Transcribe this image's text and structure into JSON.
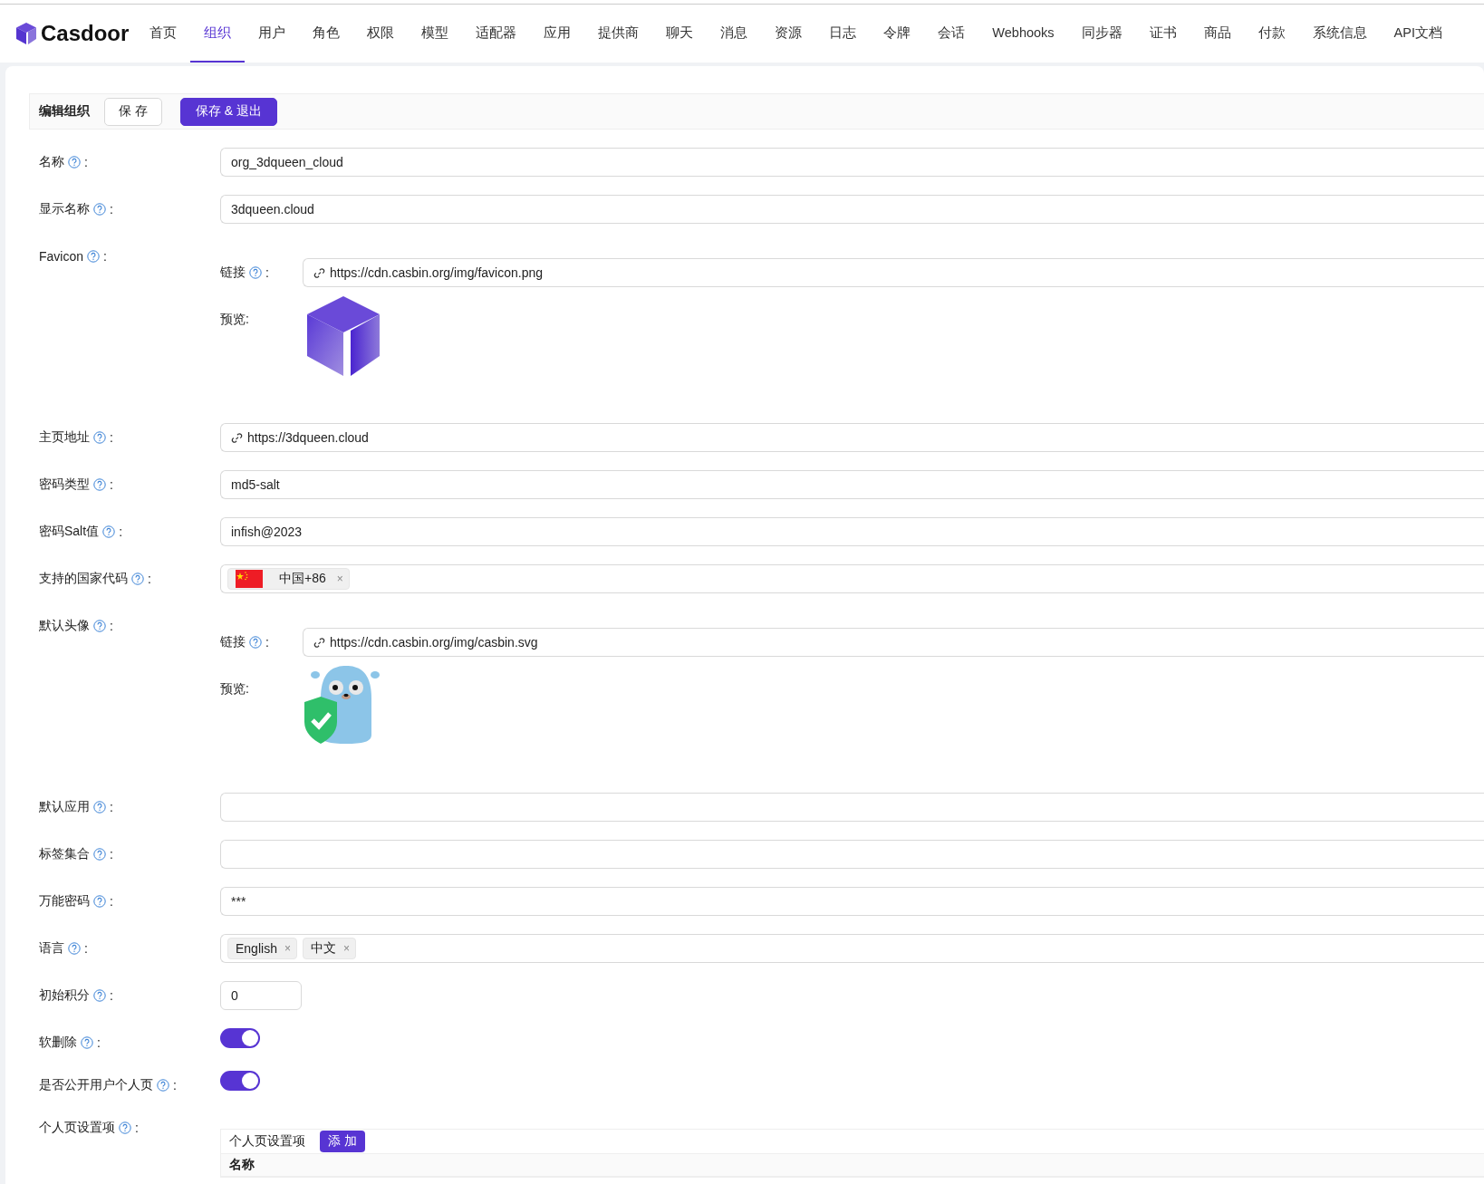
{
  "nav": {
    "logo": "Casdoor",
    "items": [
      {
        "label": "首页",
        "selected": false
      },
      {
        "label": "组织",
        "selected": true
      },
      {
        "label": "用户",
        "selected": false
      },
      {
        "label": "角色",
        "selected": false
      },
      {
        "label": "权限",
        "selected": false
      },
      {
        "label": "模型",
        "selected": false
      },
      {
        "label": "适配器",
        "selected": false
      },
      {
        "label": "应用",
        "selected": false
      },
      {
        "label": "提供商",
        "selected": false
      },
      {
        "label": "聊天",
        "selected": false
      },
      {
        "label": "消息",
        "selected": false
      },
      {
        "label": "资源",
        "selected": false
      },
      {
        "label": "日志",
        "selected": false
      },
      {
        "label": "令牌",
        "selected": false
      },
      {
        "label": "会话",
        "selected": false
      },
      {
        "label": "Webhooks",
        "selected": false
      },
      {
        "label": "同步器",
        "selected": false
      },
      {
        "label": "证书",
        "selected": false
      },
      {
        "label": "商品",
        "selected": false
      },
      {
        "label": "付款",
        "selected": false
      },
      {
        "label": "系统信息",
        "selected": false
      },
      {
        "label": "API文档",
        "selected": false
      }
    ]
  },
  "toolbar": {
    "title": "编辑组织",
    "buttons": [
      {
        "label": "保 存",
        "kind": "default"
      },
      {
        "label": "保存 & 退出",
        "kind": "primary"
      }
    ]
  },
  "fields": [
    {
      "label": "名称",
      "colon": ":",
      "kind": "text",
      "value": "org_3dqueen_cloud"
    },
    {
      "label": "显示名称",
      "colon": ":",
      "kind": "text",
      "value": "3dqueen.cloud"
    },
    {
      "label": "Favicon",
      "colon": ":",
      "kind": "image",
      "link_label": "链接",
      "link_colon": ":",
      "url": "https://cdn.casbin.org/img/favicon.png",
      "preview": {
        "label": "预览:",
        "kind": "cube"
      }
    },
    {
      "label": "主页地址",
      "colon": ":",
      "kind": "link",
      "value": "https://3dqueen.cloud"
    },
    {
      "label": "密码类型",
      "colon": ":",
      "kind": "text",
      "value": "md5-salt"
    },
    {
      "label": "密码Salt值",
      "colon": ":",
      "kind": "text",
      "value": "infish@2023"
    },
    {
      "label": "支持的国家代码",
      "colon": ":",
      "kind": "tags",
      "tags": [
        {
          "label": "中国+86",
          "kind": "flag",
          "remove": "×"
        }
      ]
    },
    {
      "label": "默认头像",
      "colon": ":",
      "kind": "image",
      "link_label": "链接",
      "link_colon": ":",
      "url": "https://cdn.casbin.org/img/casbin.svg",
      "preview": {
        "label": "预览:",
        "kind": "gopher"
      }
    },
    {
      "label": "默认应用",
      "colon": ":",
      "kind": "text"
    },
    {
      "label": "标签集合",
      "colon": ":",
      "kind": "text"
    },
    {
      "label": "万能密码",
      "colon": ":",
      "kind": "text",
      "value": "***"
    },
    {
      "label": "语言",
      "colon": ":",
      "kind": "tags",
      "tags": [
        {
          "label": "English",
          "remove": "×"
        },
        {
          "label": "中文",
          "remove": "×"
        }
      ]
    },
    {
      "label": "初始积分",
      "colon": ":",
      "kind": "number",
      "value": "0"
    },
    {
      "label": "软删除",
      "colon": ":",
      "kind": "switch",
      "on": true
    },
    {
      "label": "是否公开用户个人页",
      "colon": ":",
      "kind": "switch",
      "on": true
    },
    {
      "label": "个人页设置项",
      "colon": ":",
      "kind": "table",
      "title": "个人页设置项",
      "add_button": "添 加",
      "columns": [
        "名称"
      ]
    }
  ]
}
